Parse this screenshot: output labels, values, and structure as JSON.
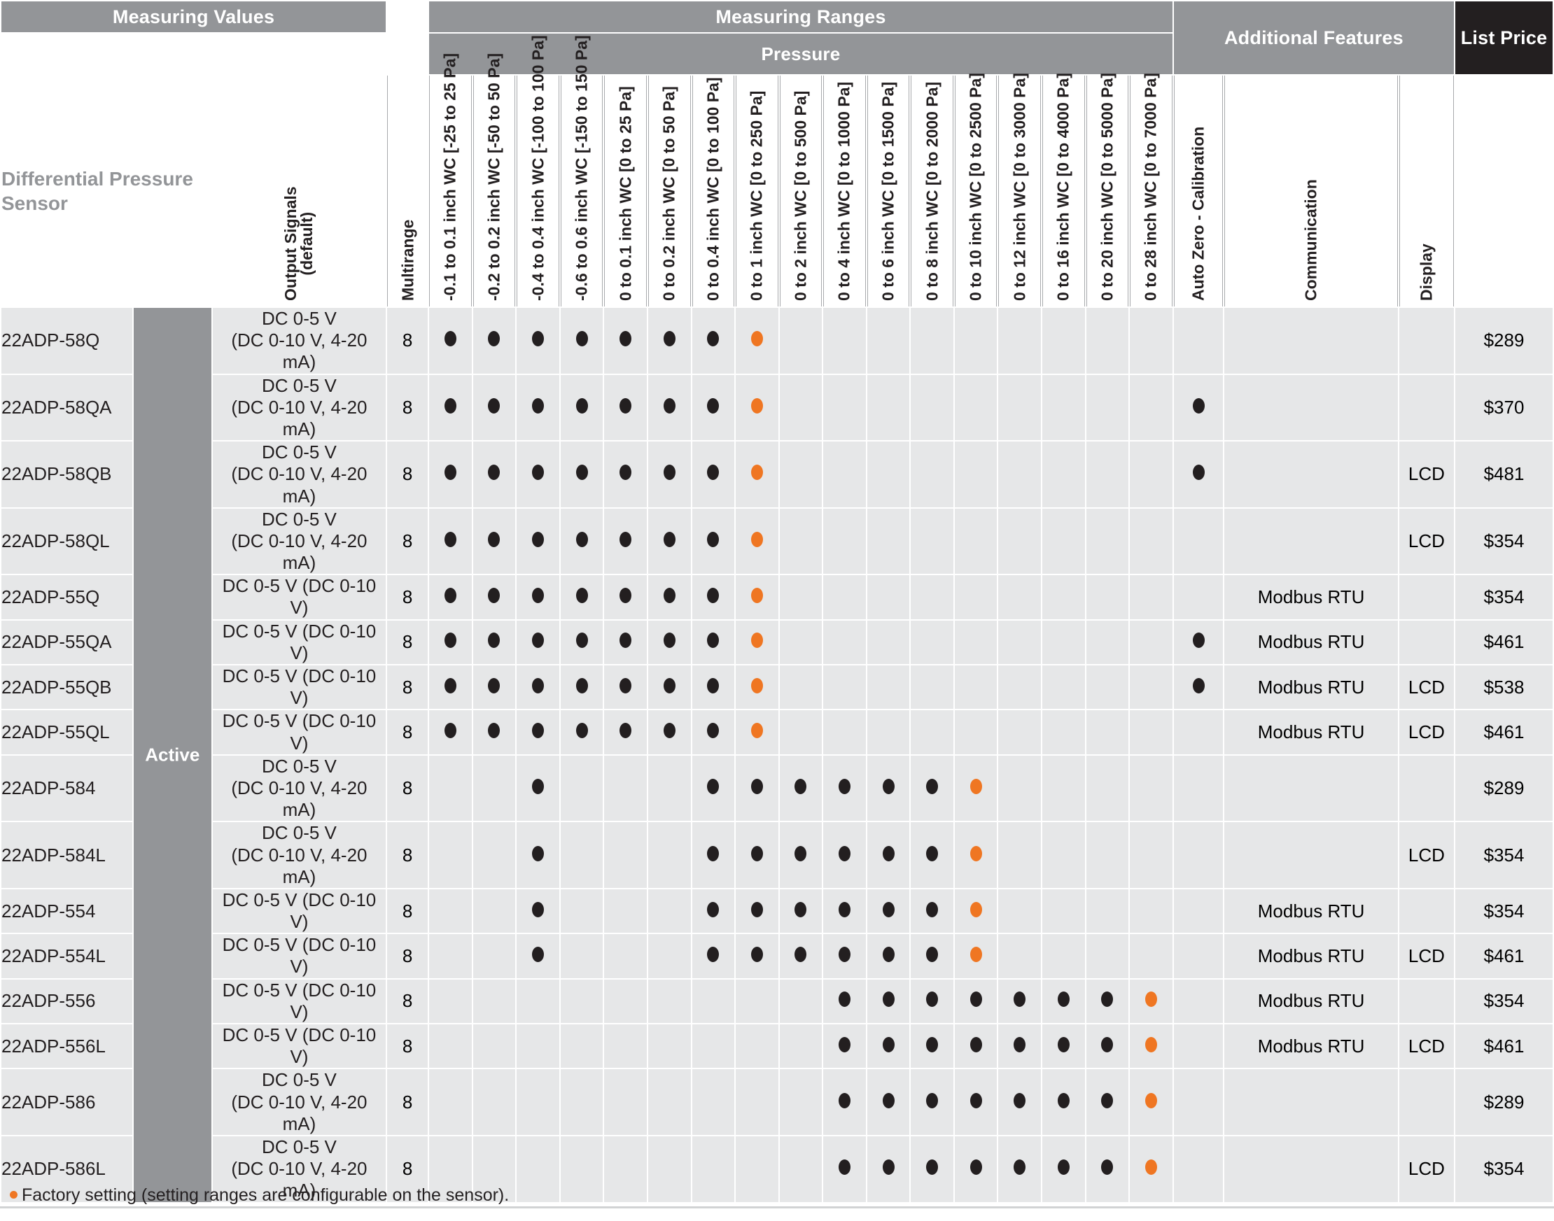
{
  "bands": {
    "measuring_values": "Measuring Values",
    "measuring_ranges": "Measuring Ranges",
    "pressure": "Pressure",
    "additional_features": "Additional Features",
    "list_price": "List Price"
  },
  "corner_title": "Differential Pressure Sensor",
  "group_label": "Active",
  "columns": {
    "output_signals": "Output Signals (default)",
    "multirange": "Multirange",
    "auto_zero": "Auto Zero - Calibration",
    "communication": "Communication",
    "display": "Display",
    "ranges": [
      "-0.1 to 0.1 inch WC [-25 to 25 Pa]",
      "-0.2 to 0.2 inch WC [-50 to 50 Pa]",
      "-0.4 to 0.4 inch WC [-100 to 100 Pa]",
      "-0.6 to 0.6 inch WC [-150 to 150 Pa]",
      "0 to 0.1 inch WC [0 to 25 Pa]",
      "0 to 0.2 inch WC [0 to 50 Pa]",
      "0 to 0.4 inch WC [0 to 100 Pa]",
      "0 to 1 inch WC [0 to 250 Pa]",
      "0 to 2 inch WC [0 to 500 Pa]",
      "0 to 4 inch WC [0 to 1000 Pa]",
      "0 to 6 inch WC [0 to 1500 Pa]",
      "0 to 8 inch WC [0 to 2000 Pa]",
      "0 to 10 inch WC [0 to 2500 Pa]",
      "0 to 12 inch WC [0 to 3000 Pa]",
      "0 to 16 inch WC [0 to 4000 Pa]",
      "0 to 20 inch WC [0 to 5000 Pa]",
      "0 to 28 inch WC [0 to 7000 Pa]"
    ]
  },
  "legend": {
    "factory_dot_color": "#ef7622",
    "standard_dot_color": "#231f20",
    "note": "Factory setting (setting ranges are configurable on the sensor)."
  },
  "rows": [
    {
      "model": "22ADP-58Q",
      "output": "DC 0-5 V\n(DC 0-10 V, 4-20 mA)",
      "multirange": "8",
      "ranges": [
        "d",
        "d",
        "d",
        "d",
        "d",
        "d",
        "d",
        "f",
        "",
        "",
        "",
        "",
        "",
        "",
        "",
        "",
        ""
      ],
      "auto_zero": "",
      "communication": "",
      "display": "",
      "price": "$289",
      "tall": true
    },
    {
      "model": "22ADP-58QA",
      "output": "DC 0-5 V\n(DC 0-10 V, 4-20 mA)",
      "multirange": "8",
      "ranges": [
        "d",
        "d",
        "d",
        "d",
        "d",
        "d",
        "d",
        "f",
        "",
        "",
        "",
        "",
        "",
        "",
        "",
        "",
        ""
      ],
      "auto_zero": "d",
      "communication": "",
      "display": "",
      "price": "$370",
      "tall": true
    },
    {
      "model": "22ADP-58QB",
      "output": "DC 0-5 V\n(DC 0-10 V, 4-20 mA)",
      "multirange": "8",
      "ranges": [
        "d",
        "d",
        "d",
        "d",
        "d",
        "d",
        "d",
        "f",
        "",
        "",
        "",
        "",
        "",
        "",
        "",
        "",
        ""
      ],
      "auto_zero": "d",
      "communication": "",
      "display": "LCD",
      "price": "$481",
      "tall": true
    },
    {
      "model": "22ADP-58QL",
      "output": "DC 0-5 V\n(DC 0-10 V, 4-20 mA)",
      "multirange": "8",
      "ranges": [
        "d",
        "d",
        "d",
        "d",
        "d",
        "d",
        "d",
        "f",
        "",
        "",
        "",
        "",
        "",
        "",
        "",
        "",
        ""
      ],
      "auto_zero": "",
      "communication": "",
      "display": "LCD",
      "price": "$354",
      "tall": true
    },
    {
      "model": "22ADP-55Q",
      "output": "DC 0-5 V (DC 0-10 V)",
      "multirange": "8",
      "ranges": [
        "d",
        "d",
        "d",
        "d",
        "d",
        "d",
        "d",
        "f",
        "",
        "",
        "",
        "",
        "",
        "",
        "",
        "",
        ""
      ],
      "auto_zero": "",
      "communication": "Modbus RTU",
      "display": "",
      "price": "$354",
      "tall": false
    },
    {
      "model": "22ADP-55QA",
      "output": "DC 0-5 V (DC 0-10 V)",
      "multirange": "8",
      "ranges": [
        "d",
        "d",
        "d",
        "d",
        "d",
        "d",
        "d",
        "f",
        "",
        "",
        "",
        "",
        "",
        "",
        "",
        "",
        ""
      ],
      "auto_zero": "d",
      "communication": "Modbus RTU",
      "display": "",
      "price": "$461",
      "tall": false
    },
    {
      "model": "22ADP-55QB",
      "output": "DC 0-5 V (DC 0-10 V)",
      "multirange": "8",
      "ranges": [
        "d",
        "d",
        "d",
        "d",
        "d",
        "d",
        "d",
        "f",
        "",
        "",
        "",
        "",
        "",
        "",
        "",
        "",
        ""
      ],
      "auto_zero": "d",
      "communication": "Modbus RTU",
      "display": "LCD",
      "price": "$538",
      "tall": false
    },
    {
      "model": "22ADP-55QL",
      "output": "DC 0-5 V (DC 0-10 V)",
      "multirange": "8",
      "ranges": [
        "d",
        "d",
        "d",
        "d",
        "d",
        "d",
        "d",
        "f",
        "",
        "",
        "",
        "",
        "",
        "",
        "",
        "",
        ""
      ],
      "auto_zero": "",
      "communication": "Modbus RTU",
      "display": "LCD",
      "price": "$461",
      "tall": false
    },
    {
      "model": "22ADP-584",
      "output": "DC 0-5 V\n(DC 0-10 V, 4-20 mA)",
      "multirange": "8",
      "ranges": [
        "",
        "",
        "d",
        "",
        "",
        "",
        "d",
        "d",
        "d",
        "d",
        "d",
        "d",
        "f",
        "",
        "",
        "",
        ""
      ],
      "auto_zero": "",
      "communication": "",
      "display": "",
      "price": "$289",
      "tall": true
    },
    {
      "model": "22ADP-584L",
      "output": "DC 0-5 V\n(DC 0-10 V, 4-20 mA)",
      "multirange": "8",
      "ranges": [
        "",
        "",
        "d",
        "",
        "",
        "",
        "d",
        "d",
        "d",
        "d",
        "d",
        "d",
        "f",
        "",
        "",
        "",
        ""
      ],
      "auto_zero": "",
      "communication": "",
      "display": "LCD",
      "price": "$354",
      "tall": true
    },
    {
      "model": "22ADP-554",
      "output": "DC 0-5 V (DC 0-10 V)",
      "multirange": "8",
      "ranges": [
        "",
        "",
        "d",
        "",
        "",
        "",
        "d",
        "d",
        "d",
        "d",
        "d",
        "d",
        "f",
        "",
        "",
        "",
        ""
      ],
      "auto_zero": "",
      "communication": "Modbus RTU",
      "display": "",
      "price": "$354",
      "tall": false
    },
    {
      "model": "22ADP-554L",
      "output": "DC 0-5 V (DC 0-10 V)",
      "multirange": "8",
      "ranges": [
        "",
        "",
        "d",
        "",
        "",
        "",
        "d",
        "d",
        "d",
        "d",
        "d",
        "d",
        "f",
        "",
        "",
        "",
        ""
      ],
      "auto_zero": "",
      "communication": "Modbus RTU",
      "display": "LCD",
      "price": "$461",
      "tall": false
    },
    {
      "model": "22ADP-556",
      "output": "DC 0-5 V (DC 0-10 V)",
      "multirange": "8",
      "ranges": [
        "",
        "",
        "",
        "",
        "",
        "",
        "",
        "",
        "",
        "d",
        "d",
        "d",
        "d",
        "d",
        "d",
        "d",
        "f"
      ],
      "auto_zero": "",
      "communication": "Modbus RTU",
      "display": "",
      "price": "$354",
      "tall": false
    },
    {
      "model": "22ADP-556L",
      "output": "DC 0-5 V (DC 0-10 V)",
      "multirange": "8",
      "ranges": [
        "",
        "",
        "",
        "",
        "",
        "",
        "",
        "",
        "",
        "d",
        "d",
        "d",
        "d",
        "d",
        "d",
        "d",
        "f"
      ],
      "auto_zero": "",
      "communication": "Modbus RTU",
      "display": "LCD",
      "price": "$461",
      "tall": false
    },
    {
      "model": "22ADP-586",
      "output": "DC 0-5 V\n(DC 0-10 V, 4-20 mA)",
      "multirange": "8",
      "ranges": [
        "",
        "",
        "",
        "",
        "",
        "",
        "",
        "",
        "",
        "d",
        "d",
        "d",
        "d",
        "d",
        "d",
        "d",
        "f"
      ],
      "auto_zero": "",
      "communication": "",
      "display": "",
      "price": "$289",
      "tall": true
    },
    {
      "model": "22ADP-586L",
      "output": "DC 0-5 V\n(DC 0-10 V, 4-20 mA)",
      "multirange": "8",
      "ranges": [
        "",
        "",
        "",
        "",
        "",
        "",
        "",
        "",
        "",
        "d",
        "d",
        "d",
        "d",
        "d",
        "d",
        "d",
        "f"
      ],
      "auto_zero": "",
      "communication": "",
      "display": "LCD",
      "price": "$354",
      "tall": true
    }
  ]
}
